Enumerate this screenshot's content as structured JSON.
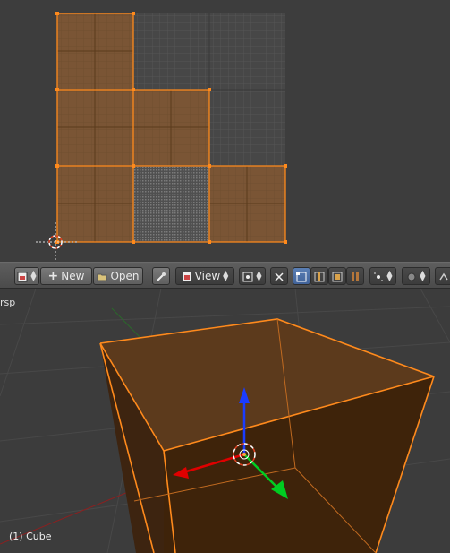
{
  "uv_editor": {
    "uv_color": "#7a5535",
    "edge_color": "#ff8a1c",
    "image_bg_color": "#474747"
  },
  "header": {
    "image_icon": "image-browse-icon",
    "new_label": "New",
    "open_label": "Open",
    "pin_icon": "pin-icon",
    "view_menu_label": "View",
    "pivot_icon": "pivot-point-icon",
    "sync_icon": "uv-sync-icon",
    "select_mode_icons": [
      "vertex-select-icon",
      "edge-select-icon",
      "face-select-icon",
      "island-select-icon"
    ],
    "sticky_icon": "sticky-selection-icon",
    "proportional_icon": "proportional-edit-icon",
    "snap_icon": "snap-icon"
  },
  "viewport": {
    "view_name": "rsp",
    "object_label": "(1) Cube",
    "mesh_color": "#4a2c14",
    "wire_color": "#ff8a1c",
    "axis_colors": {
      "x": "#e00000",
      "y": "#00cc22",
      "z": "#1a3cff"
    }
  }
}
